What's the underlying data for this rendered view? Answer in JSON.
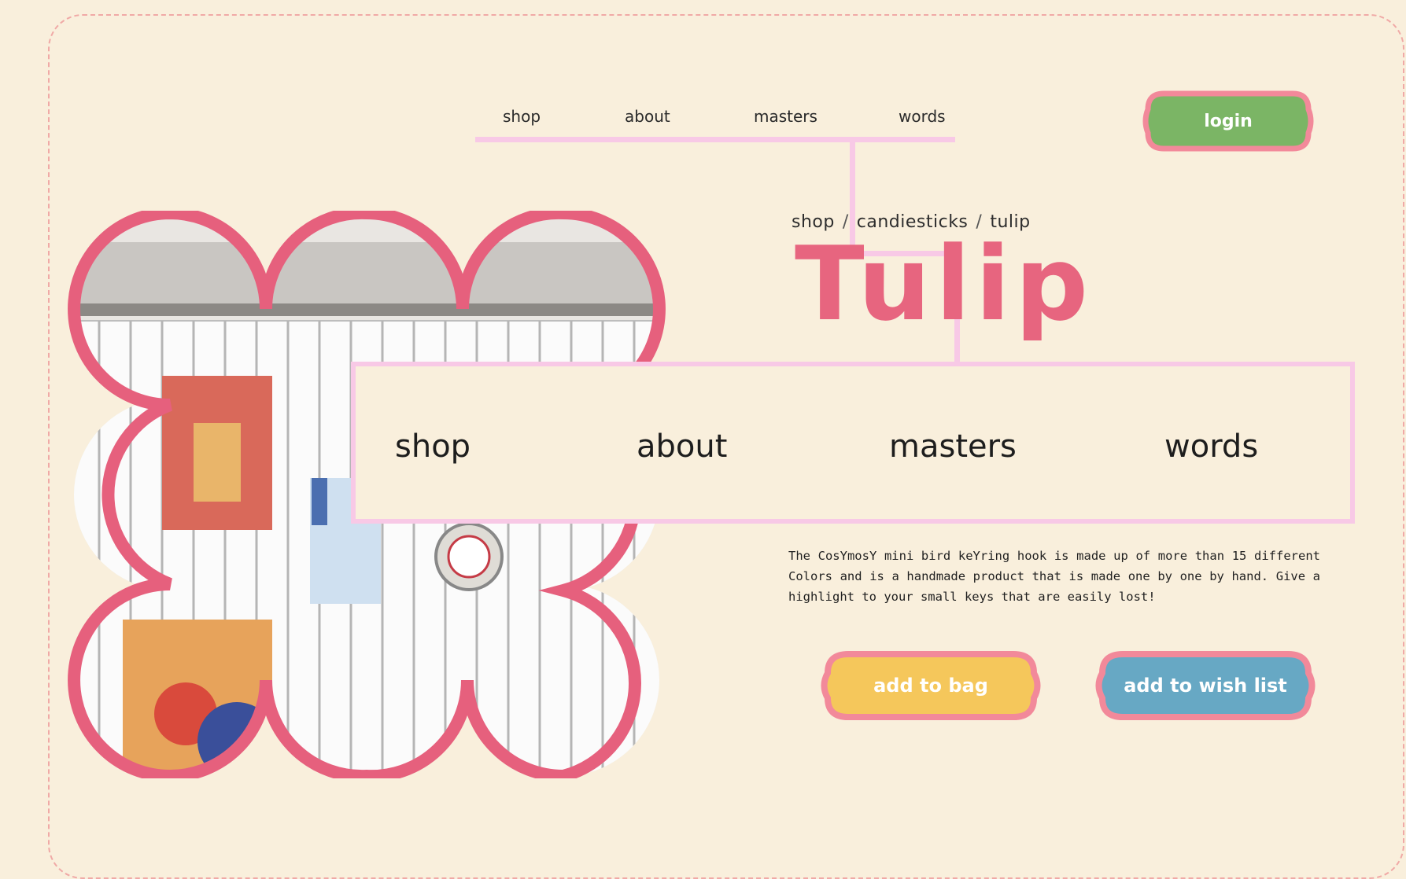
{
  "nav": {
    "items": [
      "shop",
      "about",
      "masters",
      "words"
    ]
  },
  "login": {
    "label": "login",
    "color": "#7bb565",
    "border": "#f2899a"
  },
  "breadcrumb": {
    "items": [
      "shop",
      "candiesticks",
      "tulip"
    ],
    "separator": "/"
  },
  "product": {
    "title": "Tulip",
    "description": "The CosYmosY mini bird keYring hook is made up of more than 15 different Colors and is a handmade product that is made one by one by hand. Give a highlight to your small keys that are easily lost!"
  },
  "dropdown": {
    "items": [
      "shop",
      "about",
      "masters",
      "words"
    ]
  },
  "actions": {
    "add_to_bag": "add to bag",
    "add_to_wish": "add to wish list",
    "bag_color": "#f5c75b",
    "wish_color": "#67a8c4",
    "border_color": "#f2899a"
  },
  "image": {
    "frame_color": "#e6607d",
    "icons": [
      "product-photo-frame"
    ]
  }
}
